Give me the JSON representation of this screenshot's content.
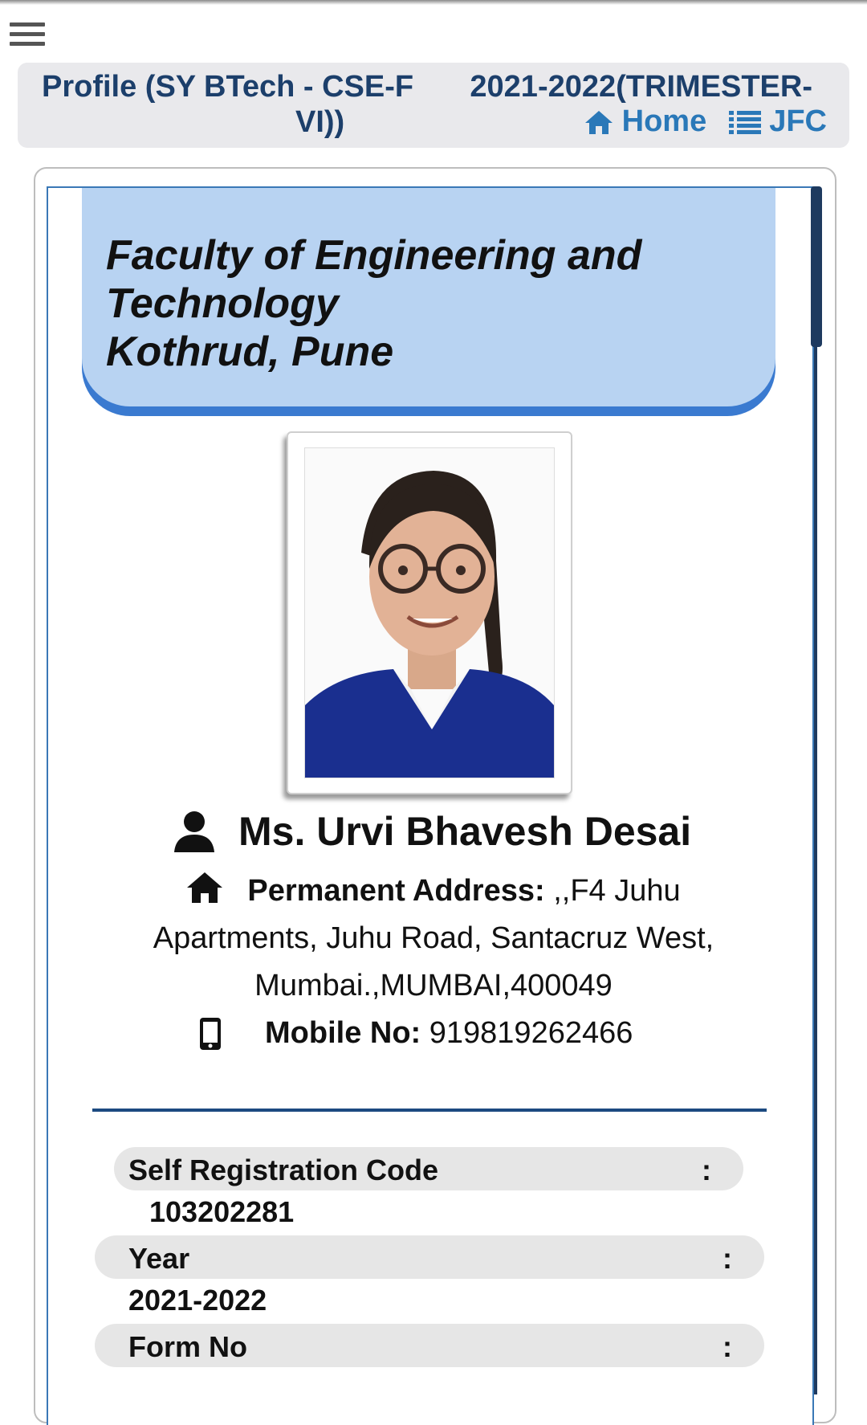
{
  "header": {
    "title_line1_left": "Profile  (SY BTech - CSE-F",
    "title_line1_right": "2021-2022(TRIMESTER-",
    "title_line2": "VI))",
    "nav": [
      {
        "label": "Home",
        "icon": "home-icon"
      },
      {
        "label": "JFC",
        "icon": "list-icon"
      }
    ]
  },
  "banner": {
    "line1": "Faculty of Engineering and",
    "line2": "Technology",
    "line3": "Kothrud, Pune"
  },
  "profile": {
    "name": "Ms. Urvi Bhavesh Desai",
    "address_label": "Permanent Address:",
    "address_value": " ,,F4 Juhu Apartments, Juhu Road, Santacruz West, Mumbai.,MUMBAI,400049",
    "mobile_label": "Mobile No:",
    "mobile_value": " 919819262466"
  },
  "details": [
    {
      "label": "Self Registration Code",
      "colon": ":",
      "value": "103202281"
    },
    {
      "label": "Year",
      "colon": ":",
      "value": "2021-2022"
    },
    {
      "label": "Form No",
      "colon": ":"
    }
  ],
  "colors": {
    "header_text": "#1c3f6b",
    "link": "#2a78b8",
    "banner_bg": "#b8d3f2",
    "banner_shadow": "#3a7ad0",
    "divider": "#1c4a80"
  }
}
